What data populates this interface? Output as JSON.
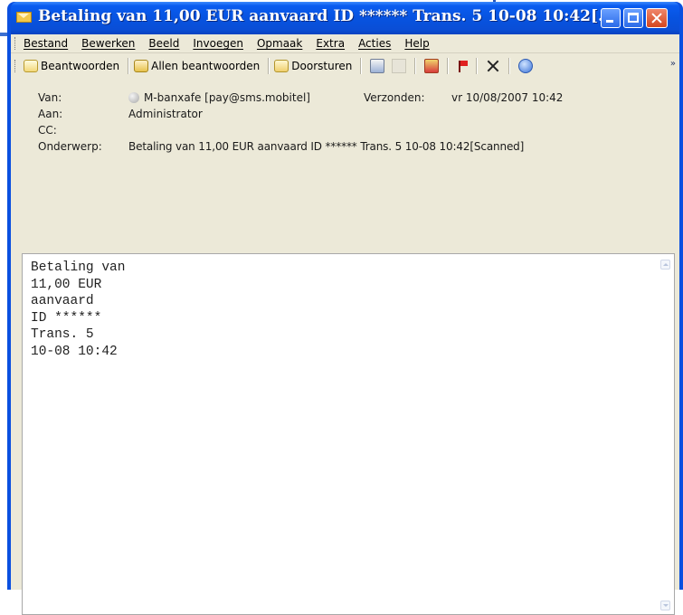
{
  "window": {
    "title": "Betaling van 11,00 EUR aanvaard ID ****** Trans. 5 10-08 10:42[..."
  },
  "menu": [
    {
      "label": "Bestand"
    },
    {
      "label": "Bewerken"
    },
    {
      "label": "Beeld"
    },
    {
      "label": "Invoegen"
    },
    {
      "label": "Opmaak"
    },
    {
      "label": "Extra"
    },
    {
      "label": "Acties"
    },
    {
      "label": "Help"
    }
  ],
  "toolbar": {
    "reply_label": "Beantwoorden",
    "reply_all_label": "Allen beantwoorden",
    "forward_label": "Doorsturen",
    "icons": [
      "print-icon",
      "copy-icon",
      "move-to-folder-icon",
      "flag-icon",
      "delete-icon",
      "help-icon"
    ]
  },
  "header": {
    "from_label": "Van:",
    "from_value": "M-banxafe [pay@sms.mobitel]",
    "sent_label": "Verzonden:",
    "sent_value": "vr 10/08/2007 10:42",
    "to_label": "Aan:",
    "to_value": "Administrator",
    "cc_label": "CC:",
    "cc_value": "",
    "subject_label": "Onderwerp:",
    "subject_value": "Betaling van 11,00 EUR aanvaard ID ****** Trans. 5 10-08 10:42[Scanned]"
  },
  "body": {
    "lines": [
      "Betaling van",
      "11,00 EUR",
      "aanvaard",
      "ID ******",
      "Trans. 5",
      "10-08 10:42"
    ]
  },
  "colors": {
    "titlebar": "#0753e0",
    "client": "#ece9d8",
    "close_button": "#d4461f"
  }
}
